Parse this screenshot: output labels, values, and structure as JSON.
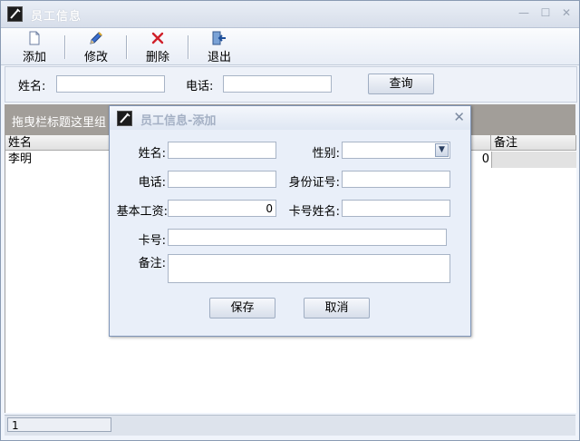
{
  "window": {
    "title": "员工信息",
    "min_glyph": "—",
    "max_glyph": "☐",
    "close_glyph": "✕"
  },
  "toolbar": {
    "add_label": "添加",
    "edit_label": "修改",
    "delete_label": "删除",
    "exit_label": "退出"
  },
  "search": {
    "name_label": "姓名:",
    "name_value": "",
    "phone_label": "电话:",
    "phone_value": "",
    "query_label": "查询"
  },
  "group_panel": {
    "hint": "拖曳栏标题这里组"
  },
  "grid": {
    "columns": [
      "姓名",
      "备注"
    ],
    "rows": [
      {
        "name": "李明",
        "value": "0",
        "note": ""
      }
    ]
  },
  "status": {
    "record": "1"
  },
  "dialog": {
    "title": "员工信息-添加",
    "close_glyph": "✕",
    "name_label": "姓名:",
    "name_value": "",
    "gender_label": "性别:",
    "gender_value": "",
    "phone_label": "电话:",
    "phone_value": "",
    "id_label": "身份证号:",
    "id_value": "",
    "salary_label": "基本工资:",
    "salary_value": "0",
    "card_name_label": "卡号姓名:",
    "card_name_value": "",
    "card_label": "卡号:",
    "card_value": "",
    "remark_label": "备注:",
    "remark_value": "",
    "save_label": "保存",
    "cancel_label": "取消"
  },
  "colors": {
    "accent": "#d0202a",
    "panel": "#a29e99",
    "dialog_bg": "#e9eff9"
  }
}
